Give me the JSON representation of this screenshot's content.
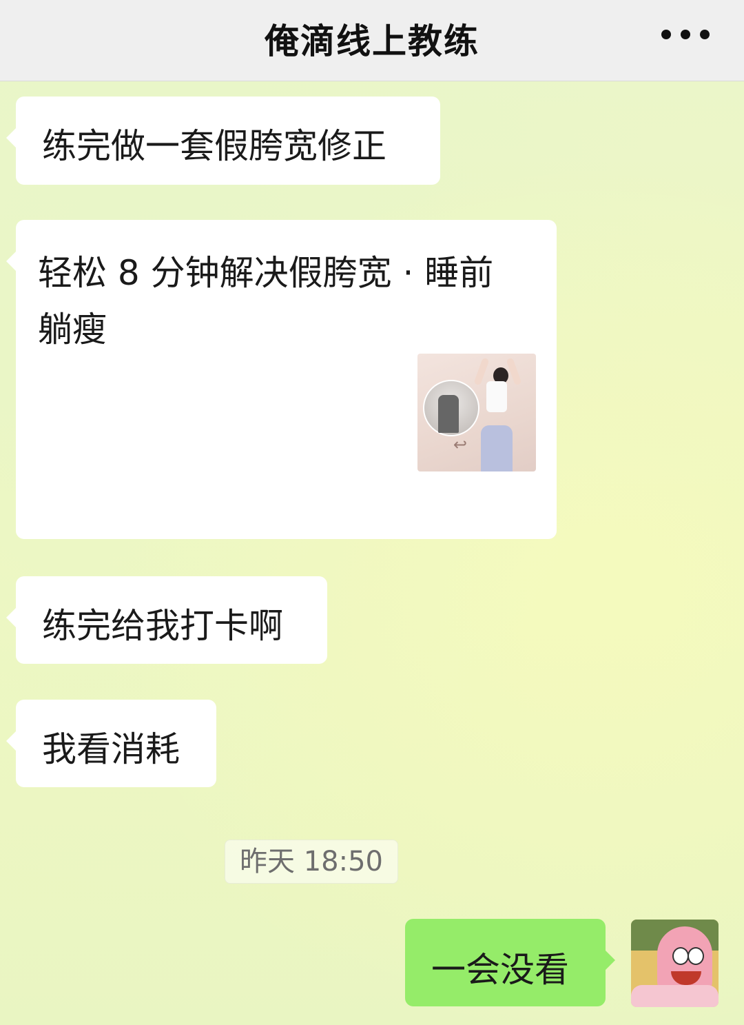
{
  "header": {
    "title": "俺滴线上教练",
    "more_icon": "more-horizontal-icon"
  },
  "messages": [
    {
      "side": "left",
      "text": "练完做一套假胯宽修正"
    },
    {
      "side": "left",
      "type": "link-card",
      "text": "轻松 8 分钟解决假胯宽 · 睡前躺瘦",
      "thumbnail_icon": "fitness-photo-thumbnail"
    },
    {
      "side": "left",
      "text": "练完给我打卡啊"
    },
    {
      "side": "left",
      "text": "我看消耗"
    },
    {
      "type": "timestamp",
      "text": "昨天 18:50"
    },
    {
      "side": "right",
      "text": "一会没看",
      "avatar": "patrick-star-avatar"
    }
  ],
  "colors": {
    "header_bg": "#efefef",
    "chat_bg": "#eef8c6",
    "incoming_bubble": "#ffffff",
    "outgoing_bubble": "#95ec69"
  }
}
